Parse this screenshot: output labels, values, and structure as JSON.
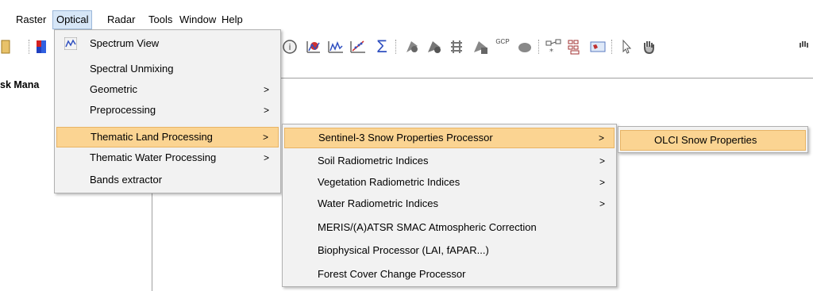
{
  "menubar": {
    "items": [
      "Raster",
      "Optical",
      "Radar",
      "Tools",
      "Window",
      "Help"
    ]
  },
  "left_panel": {
    "title": "sk Mana"
  },
  "optical_menu": {
    "items": [
      {
        "label": "Spectrum View",
        "arrow": ""
      },
      {
        "label": "Spectral Unmixing",
        "arrow": ""
      },
      {
        "label": "Geometric",
        "arrow": ">"
      },
      {
        "label": "Preprocessing",
        "arrow": ">"
      },
      {
        "label": "Thematic Land Processing",
        "arrow": ">"
      },
      {
        "label": "Thematic Water Processing",
        "arrow": ">"
      },
      {
        "label": "Bands extractor",
        "arrow": ""
      }
    ]
  },
  "thematic_land_menu": {
    "items": [
      {
        "label": "Sentinel-3 Snow Properties Processor",
        "arrow": ">"
      },
      {
        "label": "Soil Radiometric Indices",
        "arrow": ">"
      },
      {
        "label": "Vegetation Radiometric Indices",
        "arrow": ">"
      },
      {
        "label": "Water Radiometric Indices",
        "arrow": ">"
      },
      {
        "label": "MERIS/(A)ATSR SMAC Atmospheric Correction",
        "arrow": ""
      },
      {
        "label": "Biophysical Processor (LAI, fAPAR...)",
        "arrow": ""
      },
      {
        "label": "Forest Cover Change Processor",
        "arrow": ""
      }
    ]
  },
  "snow_menu": {
    "items": [
      {
        "label": "OLCI Snow Properties"
      }
    ]
  },
  "toolbar": {
    "sigma": "Σ",
    "gcp": "GCP"
  }
}
